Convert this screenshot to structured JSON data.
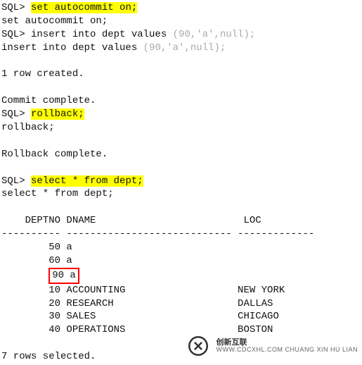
{
  "lines": {
    "p1": "SQL> ",
    "cmd1": "set autocommit on;",
    "echo1": "set autocommit on;",
    "p2": "SQL> insert into dept values ",
    "p2g": "(90,'a',null);",
    "echo2a": "insert into dept values ",
    "echo2b": "(90,'a',null);",
    "res1": "1 row created.",
    "commit": "Commit complete.",
    "p3": "SQL> ",
    "cmd3": "rollback;",
    "echo3": "rollback;",
    "rb": "Rollback complete.",
    "p4": "SQL> ",
    "cmd4": "select * from dept;",
    "echo4": "select * from dept;",
    "hdr": "    DEPTNO DNAME                         LOC",
    "dash": "---------- ---------------------------- -------------",
    "r1": "        50 a",
    "r2": "        60 a",
    "r3a": "        ",
    "r3b": "90 a",
    "r4": "        10 ACCOUNTING                   NEW YORK",
    "r5": "        20 RESEARCH                     DALLAS",
    "r6": "        30 SALES                        CHICAGO",
    "r7": "        40 OPERATIONS                   BOSTON",
    "sel": "7 rows selected."
  },
  "chart_data": {
    "type": "table",
    "title": "DEPT",
    "columns": [
      "DEPTNO",
      "DNAME",
      "LOC"
    ],
    "rows": [
      [
        50,
        "a",
        null
      ],
      [
        60,
        "a",
        null
      ],
      [
        90,
        "a",
        null
      ],
      [
        10,
        "ACCOUNTING",
        "NEW YORK"
      ],
      [
        20,
        "RESEARCH",
        "DALLAS"
      ],
      [
        30,
        "SALES",
        "CHICAGO"
      ],
      [
        40,
        "OPERATIONS",
        "BOSTON"
      ]
    ],
    "highlighted_commands": [
      "set autocommit on;",
      "rollback;",
      "select * from dept;"
    ],
    "boxed_row": {
      "DEPTNO": 90,
      "DNAME": "a"
    }
  },
  "watermark": {
    "brand": "创新互联",
    "url": "WWW.CDCXHL.COM CHUANG XIN HU LIAN"
  }
}
